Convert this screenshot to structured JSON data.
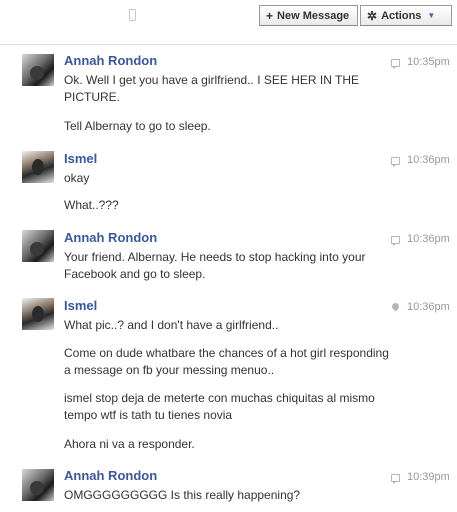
{
  "toolbar": {
    "mobile_icon": "mobile-phone-icon",
    "new_message_label": "New Message",
    "new_message_icon": "plus-icon",
    "actions_label": "Actions",
    "actions_icon": "gear-icon",
    "actions_caret": "chevron-down-icon"
  },
  "colors": {
    "name_link": "#3b5998",
    "timestamp": "#999999",
    "text": "#333333"
  },
  "messages": [
    {
      "sender": "Annah Rondon",
      "time": "10:35pm",
      "indicator": "chat-bubble-icon",
      "lines": [
        "Ok. Well I get you have a girlfriend.. I SEE HER IN THE PICTURE.",
        "Tell Albernay to go to sleep."
      ]
    },
    {
      "sender": "Ismel",
      "time": "10:36pm",
      "indicator": "chat-bubble-icon",
      "lines": [
        "okay",
        "What..???"
      ]
    },
    {
      "sender": "Annah Rondon",
      "time": "10:36pm",
      "indicator": "chat-bubble-icon",
      "lines": [
        "Your friend. Albernay. He needs to stop hacking into your Facebook and go to sleep."
      ]
    },
    {
      "sender": "Ismel",
      "time": "10:36pm",
      "indicator": "location-pin-icon",
      "lines": [
        "What pic..? and I don't have a girlfriend..",
        "Come on dude whatbare the chances of a hot girl responding a message on fb your messing menuo..",
        "ismel stop deja de meterte con muchas chiquitas al mismo tempo wtf is tath tu tienes novia",
        "Ahora ni va a responder."
      ]
    },
    {
      "sender": "Annah Rondon",
      "time": "10:39pm",
      "indicator": "chat-bubble-icon",
      "lines": [
        "OMGGGGGGGGG Is this really happening?"
      ]
    }
  ]
}
